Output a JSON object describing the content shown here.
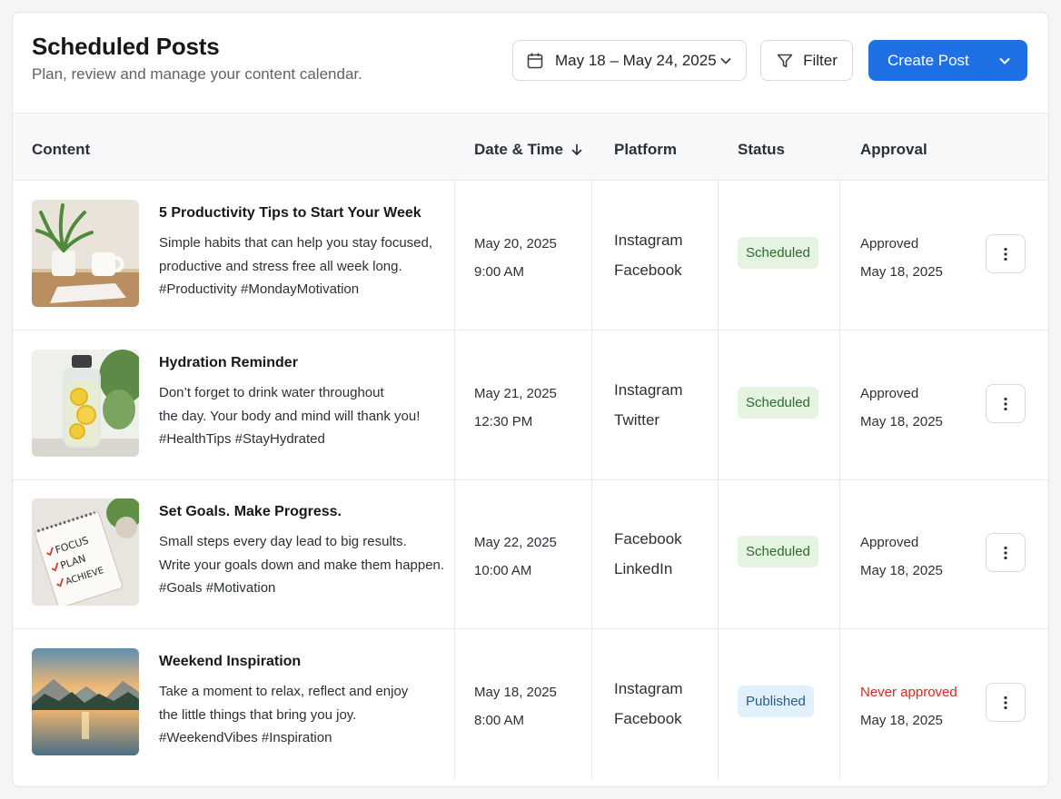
{
  "header": {
    "title": "Scheduled Posts",
    "subtitle": "Plan, review and manage your content calendar.",
    "date_range": "May 18 – May 24, 2025",
    "filter_label": "Filter",
    "create_label": "Create Post"
  },
  "table": {
    "columns": {
      "content": "Content",
      "datetime": "Date & Time",
      "platform": "Platform",
      "status": "Status",
      "approval": "Approval"
    },
    "rows": [
      {
        "title": "5 Productivity Tips to Start Your Week",
        "desc": [
          "Simple habits that can help you stay focused,",
          "productive and stress free all week long.",
          "#Productivity #MondayMotivation"
        ],
        "date": "May 20, 2025",
        "time": "9:00 AM",
        "platforms": [
          "Instagram",
          "Facebook"
        ],
        "status": "Scheduled",
        "approval": "Approved",
        "approval_date": "May 18, 2025"
      },
      {
        "title": "Hydration Reminder",
        "desc": [
          "Don’t forget to drink water throughout",
          "the day. Your body and mind will thank you!",
          "#HealthTips #StayHydrated"
        ],
        "date": "May 21, 2025",
        "time": "12:30 PM",
        "platforms": [
          "Instagram",
          "Twitter"
        ],
        "status": "Scheduled",
        "approval": "Approved",
        "approval_date": "May 18, 2025"
      },
      {
        "title": "Set Goals. Make Progress.",
        "desc": [
          "Small steps every day lead to big results.",
          "Write your goals down and make them happen.",
          "#Goals #Motivation"
        ],
        "date": "May 22, 2025",
        "time": "10:00 AM",
        "platforms": [
          "Facebook",
          "LinkedIn"
        ],
        "status": "Scheduled",
        "approval": "Approved",
        "approval_date": "May 18, 2025",
        "thumb_text": [
          "FOCUS",
          "PLAN",
          "ACHIEVE"
        ]
      },
      {
        "title": "Weekend Inspiration",
        "desc": [
          "Take a moment to relax, reflect and enjoy",
          "the little things that bring you joy.",
          "#WeekendVibes #Inspiration"
        ],
        "date": "May 18, 2025",
        "time": "8:00 AM",
        "platforms": [
          "Instagram",
          "Facebook"
        ],
        "status": "Published",
        "approval": "Never approved",
        "approval_date": "May 18, 2025"
      }
    ]
  },
  "colors": {
    "primary": "#1f6fe5",
    "scheduled_bg": "#e5f4e1",
    "scheduled_text": "#2d6a2e",
    "published_bg": "#e2f0fb",
    "published_text": "#1f5f92",
    "never_approved": "#e0261c"
  },
  "icons": {
    "date_picker": "calendar-icon",
    "dropdown": "chevron-down-icon",
    "filter": "filter-icon",
    "sort": "arrow-down-icon",
    "row_actions": "more-vertical-icon"
  }
}
